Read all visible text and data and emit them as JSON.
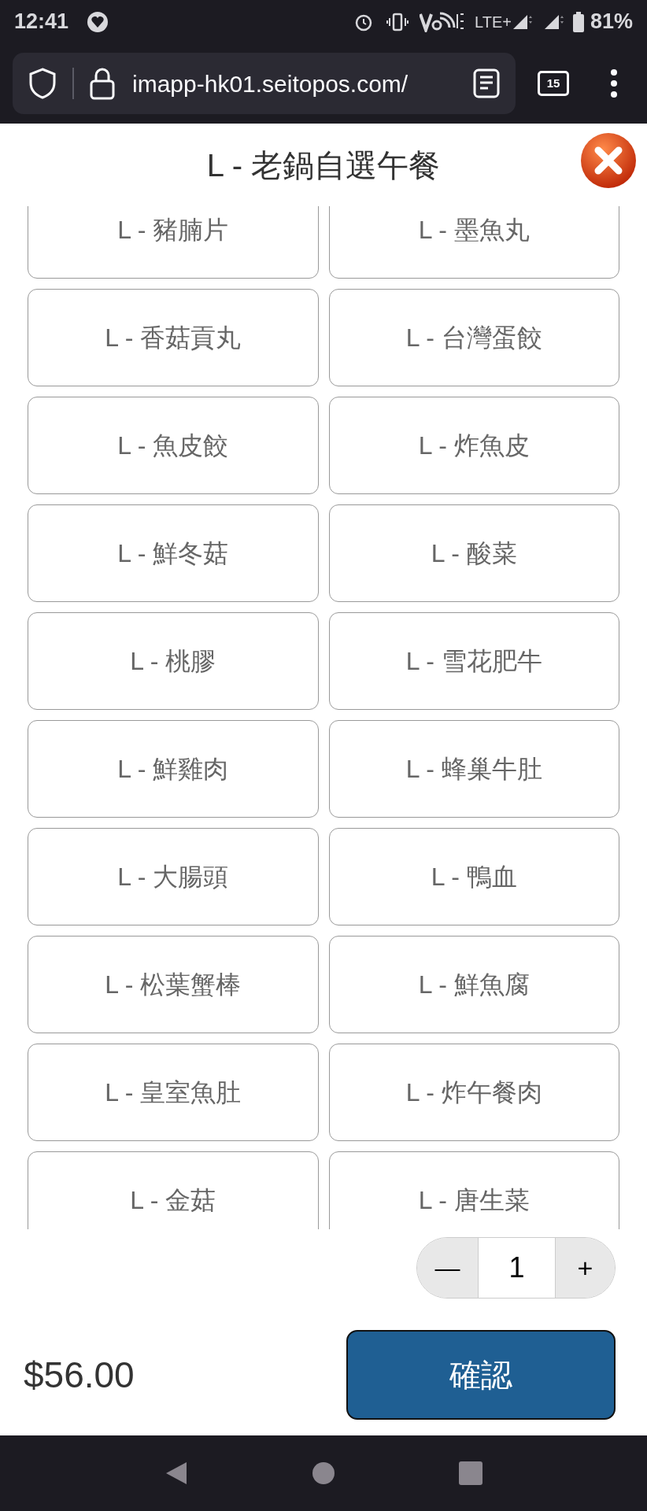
{
  "status_bar": {
    "time": "12:41",
    "network": "LTE+",
    "battery": "81%"
  },
  "browser": {
    "url": "imapp-hk01.seitopos.com/",
    "tab_count": "15"
  },
  "dialog": {
    "title": "L - 老鍋自選午餐",
    "items": [
      {
        "label": "L - 豬腩片"
      },
      {
        "label": "L - 墨魚丸"
      },
      {
        "label": "L - 香菇貢丸"
      },
      {
        "label": "L - 台灣蛋餃"
      },
      {
        "label": "L - 魚皮餃"
      },
      {
        "label": "L - 炸魚皮"
      },
      {
        "label": "L - 鮮冬菇"
      },
      {
        "label": "L - 酸菜"
      },
      {
        "label": "L - 桃膠"
      },
      {
        "label": "L - 雪花肥牛"
      },
      {
        "label": "L - 鮮雞肉"
      },
      {
        "label": "L - 蜂巢牛肚"
      },
      {
        "label": "L - 大腸頭"
      },
      {
        "label": "L - 鴨血"
      },
      {
        "label": "L - 松葉蟹棒"
      },
      {
        "label": "L - 鮮魚腐"
      },
      {
        "label": "L - 皇室魚肚"
      },
      {
        "label": "L - 炸午餐肉"
      },
      {
        "label": "L - 金菇"
      },
      {
        "label": "L - 唐生菜"
      }
    ],
    "quantity": {
      "minus": "—",
      "value": "1",
      "plus": "+"
    },
    "price": "$56.00",
    "confirm": "確認"
  }
}
